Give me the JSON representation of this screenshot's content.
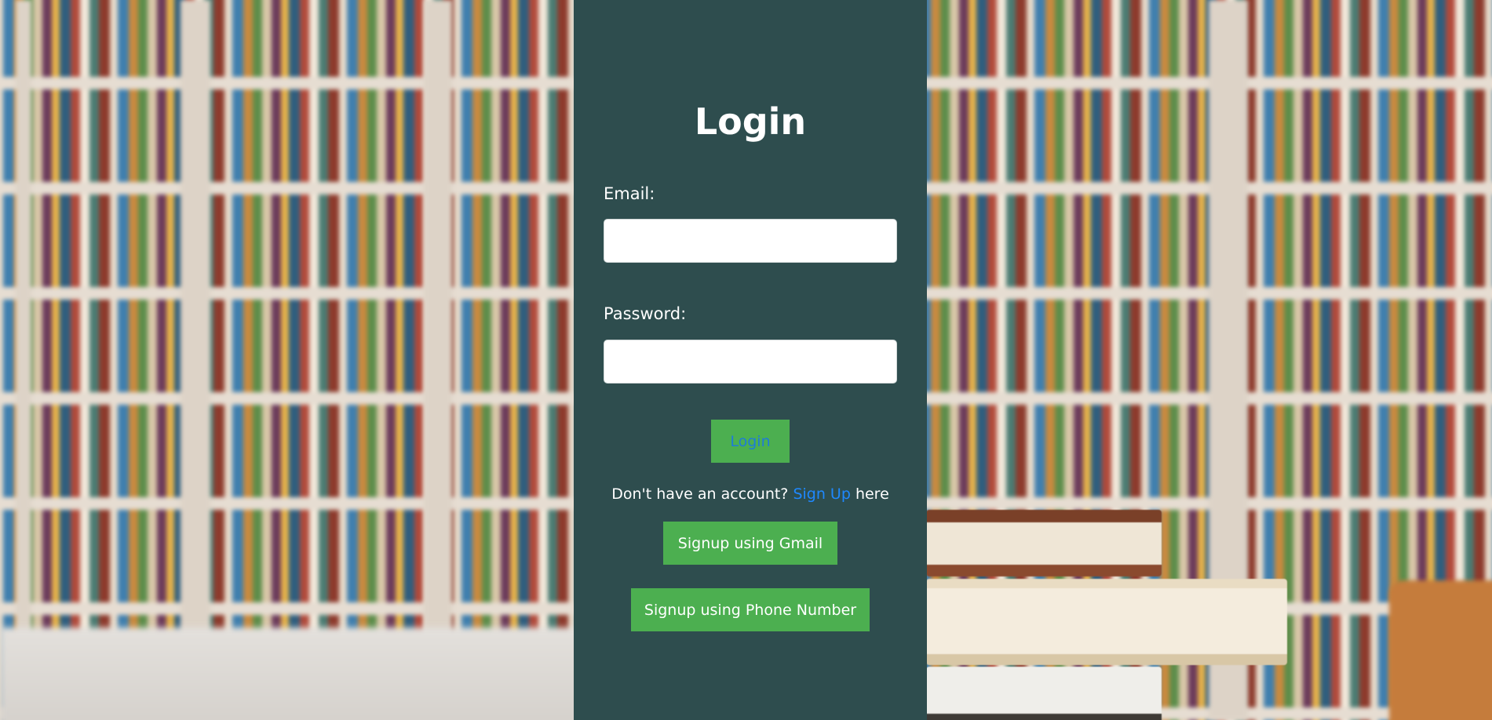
{
  "login": {
    "title": "Login",
    "email_label": "Email:",
    "email_value": "",
    "password_label": "Password:",
    "password_value": "",
    "submit_label": "Login",
    "signup_prompt_prefix": "Don't have an account?",
    "signup_link": "Sign Up",
    "signup_prompt_suffix": "here",
    "gmail_button": "Signup using Gmail",
    "phone_button": "Signup using Phone Number"
  },
  "colors": {
    "panel": "#2e4d4e",
    "button": "#4caf50",
    "link": "#1e88ff"
  }
}
